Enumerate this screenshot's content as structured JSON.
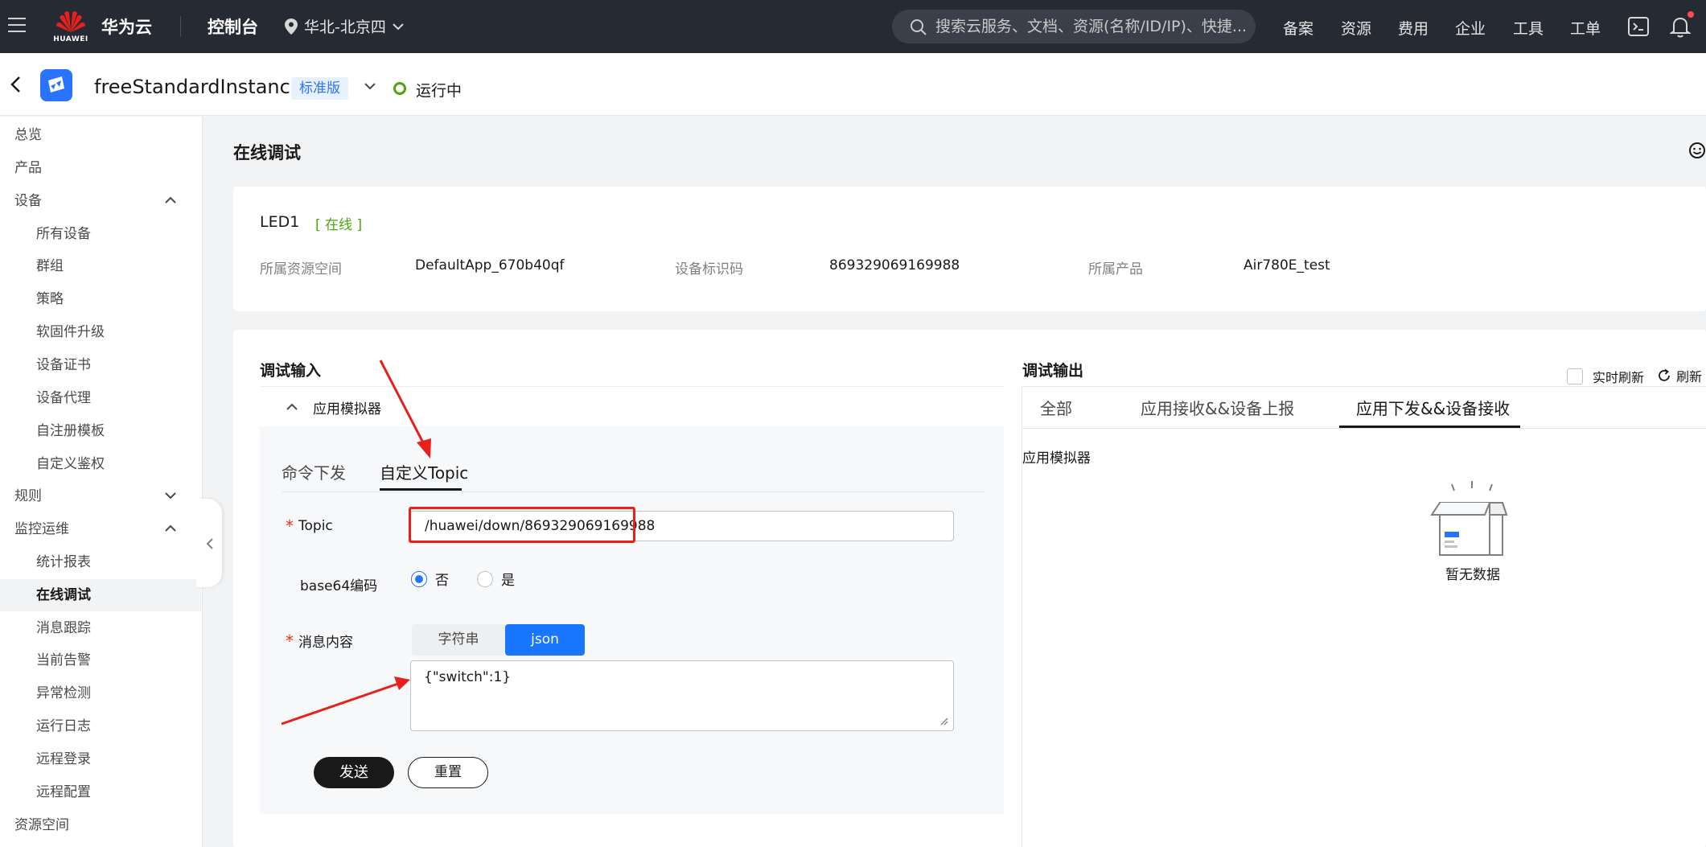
{
  "topbar": {
    "brand": "华为云",
    "logo_text": "HUAWEI",
    "console": "控制台",
    "region": "华北-北京四",
    "search_placeholder": "搜索云服务、文档、资源(名称/ID/IP)、快捷...",
    "links": [
      "备案",
      "资源",
      "费用",
      "企业",
      "工具",
      "工单"
    ]
  },
  "instance": {
    "name": "freeStandardInstance",
    "edition": "标准版",
    "status": "运行中",
    "status_color": "#4ea50f"
  },
  "sidebar": {
    "items": [
      {
        "label": "总览",
        "level": 1
      },
      {
        "label": "产品",
        "level": 1
      },
      {
        "label": "设备",
        "level": 1,
        "chevron": "up"
      },
      {
        "label": "所有设备",
        "level": 2
      },
      {
        "label": "群组",
        "level": 2
      },
      {
        "label": "策略",
        "level": 2
      },
      {
        "label": "软固件升级",
        "level": 2
      },
      {
        "label": "设备证书",
        "level": 2
      },
      {
        "label": "设备代理",
        "level": 2
      },
      {
        "label": "自注册模板",
        "level": 2
      },
      {
        "label": "自定义鉴权",
        "level": 2
      },
      {
        "label": "规则",
        "level": 1,
        "chevron": "down"
      },
      {
        "label": "监控运维",
        "level": 1,
        "chevron": "up"
      },
      {
        "label": "统计报表",
        "level": 2
      },
      {
        "label": "在线调试",
        "level": 2,
        "active": true
      },
      {
        "label": "消息跟踪",
        "level": 2
      },
      {
        "label": "当前告警",
        "level": 2
      },
      {
        "label": "异常检测",
        "level": 2
      },
      {
        "label": "运行日志",
        "level": 2
      },
      {
        "label": "远程登录",
        "level": 2
      },
      {
        "label": "远程配置",
        "level": 2
      },
      {
        "label": "资源空间",
        "level": 1
      }
    ]
  },
  "page": {
    "title": "在线调试"
  },
  "device": {
    "name": "LED1",
    "status": "[ 在线 ]",
    "fields": [
      {
        "label": "所属资源空间",
        "value": "DefaultApp_670b40qf"
      },
      {
        "label": "设备标识码",
        "value": "869329069169988"
      },
      {
        "label": "所属产品",
        "value": "Air780E_test"
      }
    ]
  },
  "debug_input": {
    "title": "调试输入",
    "simulator": "应用模拟器",
    "tabs": [
      "命令下发",
      "自定义Topic"
    ],
    "active_tab": 1,
    "topic_label": "Topic",
    "topic_value": "/huawei/down/869329069169988",
    "base64_label": "base64编码",
    "radio_no": "否",
    "radio_yes": "是",
    "radio_selected": "否",
    "message_label": "消息内容",
    "format_string": "字符串",
    "format_json": "json",
    "format_selected": "json",
    "message_value": "{\"switch\":1}",
    "send_label": "发送",
    "reset_label": "重置"
  },
  "debug_output": {
    "title": "调试输出",
    "realtime_label": "实时刷新",
    "refresh_label": "刷新",
    "tabs": [
      "全部",
      "应用接收&&设备上报",
      "应用下发&&设备接收"
    ],
    "active_tab": 2,
    "simulator": "应用模拟器",
    "empty_text": "暂无数据"
  },
  "colors": {
    "accent": "#1a75ff",
    "annotation": "#e8201c"
  }
}
